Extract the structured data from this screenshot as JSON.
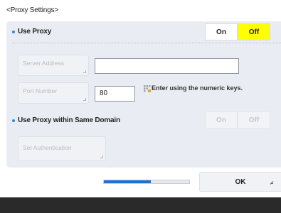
{
  "screen": {
    "title": "<Proxy Settings>"
  },
  "use_proxy": {
    "label": "Use Proxy",
    "on_label": "On",
    "off_label": "Off",
    "selected": "Off"
  },
  "server_address": {
    "button_label": "Server Address",
    "value": ""
  },
  "port_number": {
    "button_label": "Port Number",
    "value": "80",
    "hint": "Enter using the numeric keys."
  },
  "same_domain": {
    "label": "Use Proxy within Same Domain",
    "on_label": "On",
    "off_label": "Off"
  },
  "set_authentication": {
    "button_label": "Set Authentication"
  },
  "footer": {
    "progress_fraction": 0.55,
    "ok_label": "OK"
  },
  "colors": {
    "selected": "#ffff00",
    "bullet": "#2b8be0",
    "progress": "#1f71d1",
    "panel": "#e9edf3"
  },
  "icons": {
    "hint": "numeric-keypad-icon"
  }
}
